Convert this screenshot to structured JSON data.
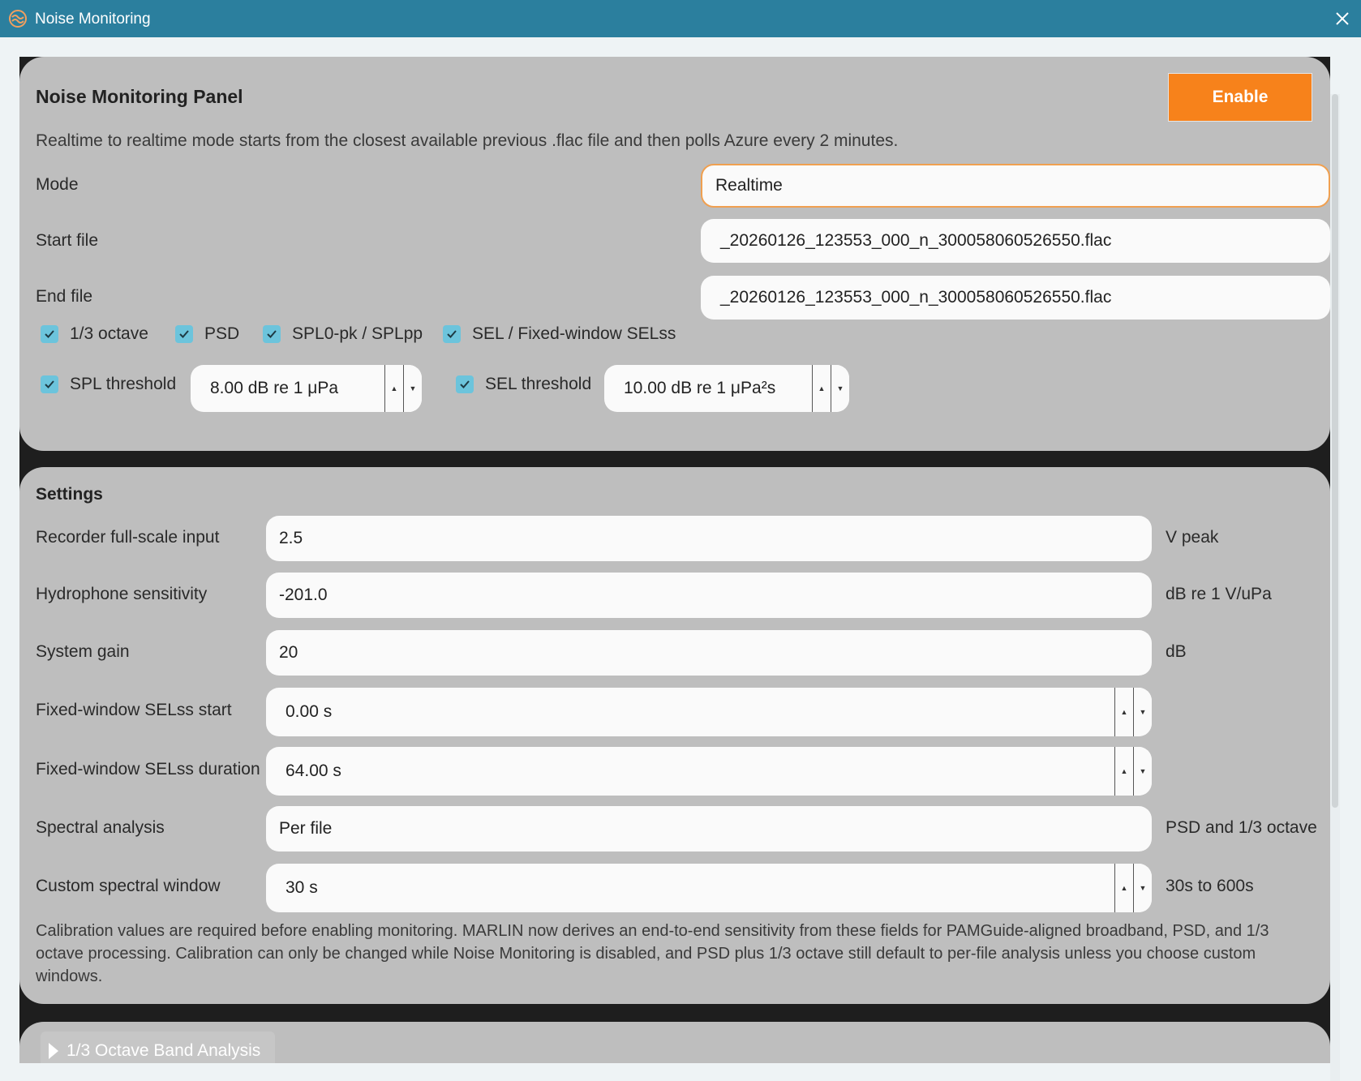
{
  "window": {
    "title": "Noise Monitoring"
  },
  "monitor": {
    "heading": "Noise Monitoring Panel",
    "enable_label": "Enable",
    "description": "Realtime to realtime mode starts from the closest available previous .flac file and then polls Azure every 2 minutes.",
    "mode_label": "Mode",
    "mode_value": "Realtime",
    "start_label": "Start file",
    "start_value": "_20260126_123553_000_n_300058060526550.flac",
    "end_label": "End file",
    "end_value": "_20260126_123553_000_n_300058060526550.flac",
    "checks": [
      "1/3 octave",
      "PSD",
      "SPL0-pk / SPLpp",
      "SEL / Fixed-window SELss"
    ],
    "spl_threshold_label": "SPL threshold",
    "spl_threshold_value": "8.00 dB re 1 μPa",
    "sel_threshold_label": "SEL threshold",
    "sel_threshold_value": "10.00 dB re 1 μPa²s"
  },
  "settings": {
    "heading": "Settings",
    "rows": [
      {
        "label": "Recorder full-scale input",
        "value": "2.5",
        "unit": "V peak"
      },
      {
        "label": "Hydrophone sensitivity",
        "value": "-201.0",
        "unit": "dB re 1 V/uPa"
      },
      {
        "label": "System gain",
        "value": "20",
        "unit": "dB"
      },
      {
        "label": "Fixed-window SELss start",
        "value": "0.00 s",
        "unit": ""
      },
      {
        "label": "Fixed-window SELss duration",
        "value": "64.00 s",
        "unit": ""
      },
      {
        "label": "Spectral analysis",
        "value": "Per file",
        "unit": "PSD and 1/3 octave"
      },
      {
        "label": "Custom spectral window",
        "value": "30 s",
        "unit": "30s to 600s"
      }
    ],
    "note": "Calibration values are required before enabling monitoring. MARLIN now derives an end-to-end sensitivity from these fields for PAMGuide-aligned broadband, PSD, and 1/3 octave processing. Calibration can only be changed while Noise Monitoring is disabled, and PSD plus 1/3 octave still default to per-file analysis unless you choose custom windows."
  },
  "octave": {
    "label": "1/3 Octave Band Analysis"
  }
}
